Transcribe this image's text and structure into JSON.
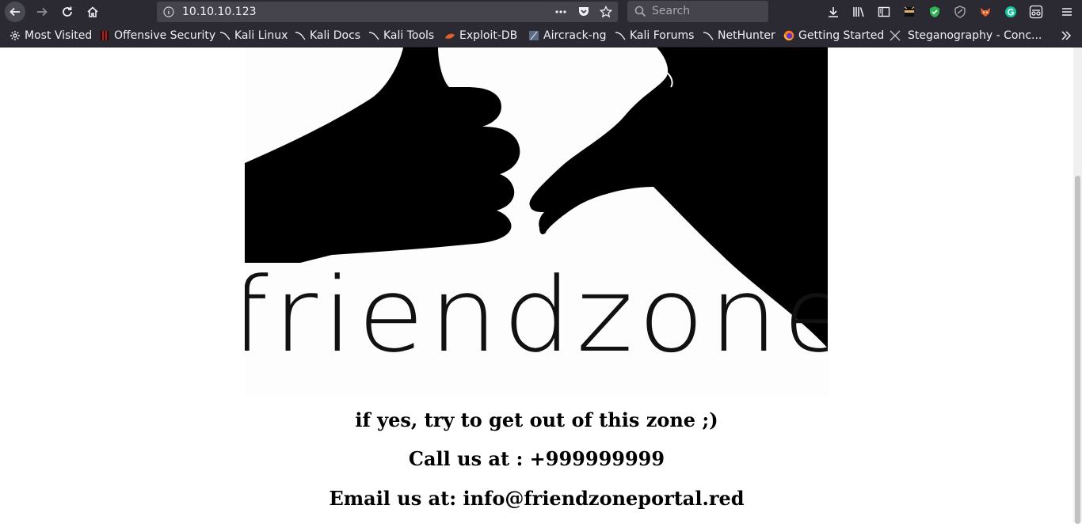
{
  "browser": {
    "url": "10.10.10.123",
    "search_placeholder": "Search",
    "bookmarks": [
      {
        "label": "Most Visited",
        "icon": "gear-icon"
      },
      {
        "label": "Offensive Security",
        "icon": "offsec-icon"
      },
      {
        "label": "Kali Linux",
        "icon": "kali-dragon-icon"
      },
      {
        "label": "Kali Docs",
        "icon": "kali-dragon-icon"
      },
      {
        "label": "Kali Tools",
        "icon": "kali-dragon-icon"
      },
      {
        "label": "Exploit-DB",
        "icon": "exploitdb-icon"
      },
      {
        "label": "Aircrack-ng",
        "icon": "aircrack-icon"
      },
      {
        "label": "Kali Forums",
        "icon": "kali-dragon-icon"
      },
      {
        "label": "NetHunter",
        "icon": "kali-dragon-icon"
      },
      {
        "label": "Getting Started",
        "icon": "firefox-icon"
      },
      {
        "label": "Steganography - Conc...",
        "icon": "x-icon"
      }
    ]
  },
  "page": {
    "logo_text": "friendzone",
    "line1": "if yes, try to get out of this zone ;)",
    "line2": "Call us at : +999999999",
    "line3": "Email us at: info@friendzoneportal.red"
  }
}
